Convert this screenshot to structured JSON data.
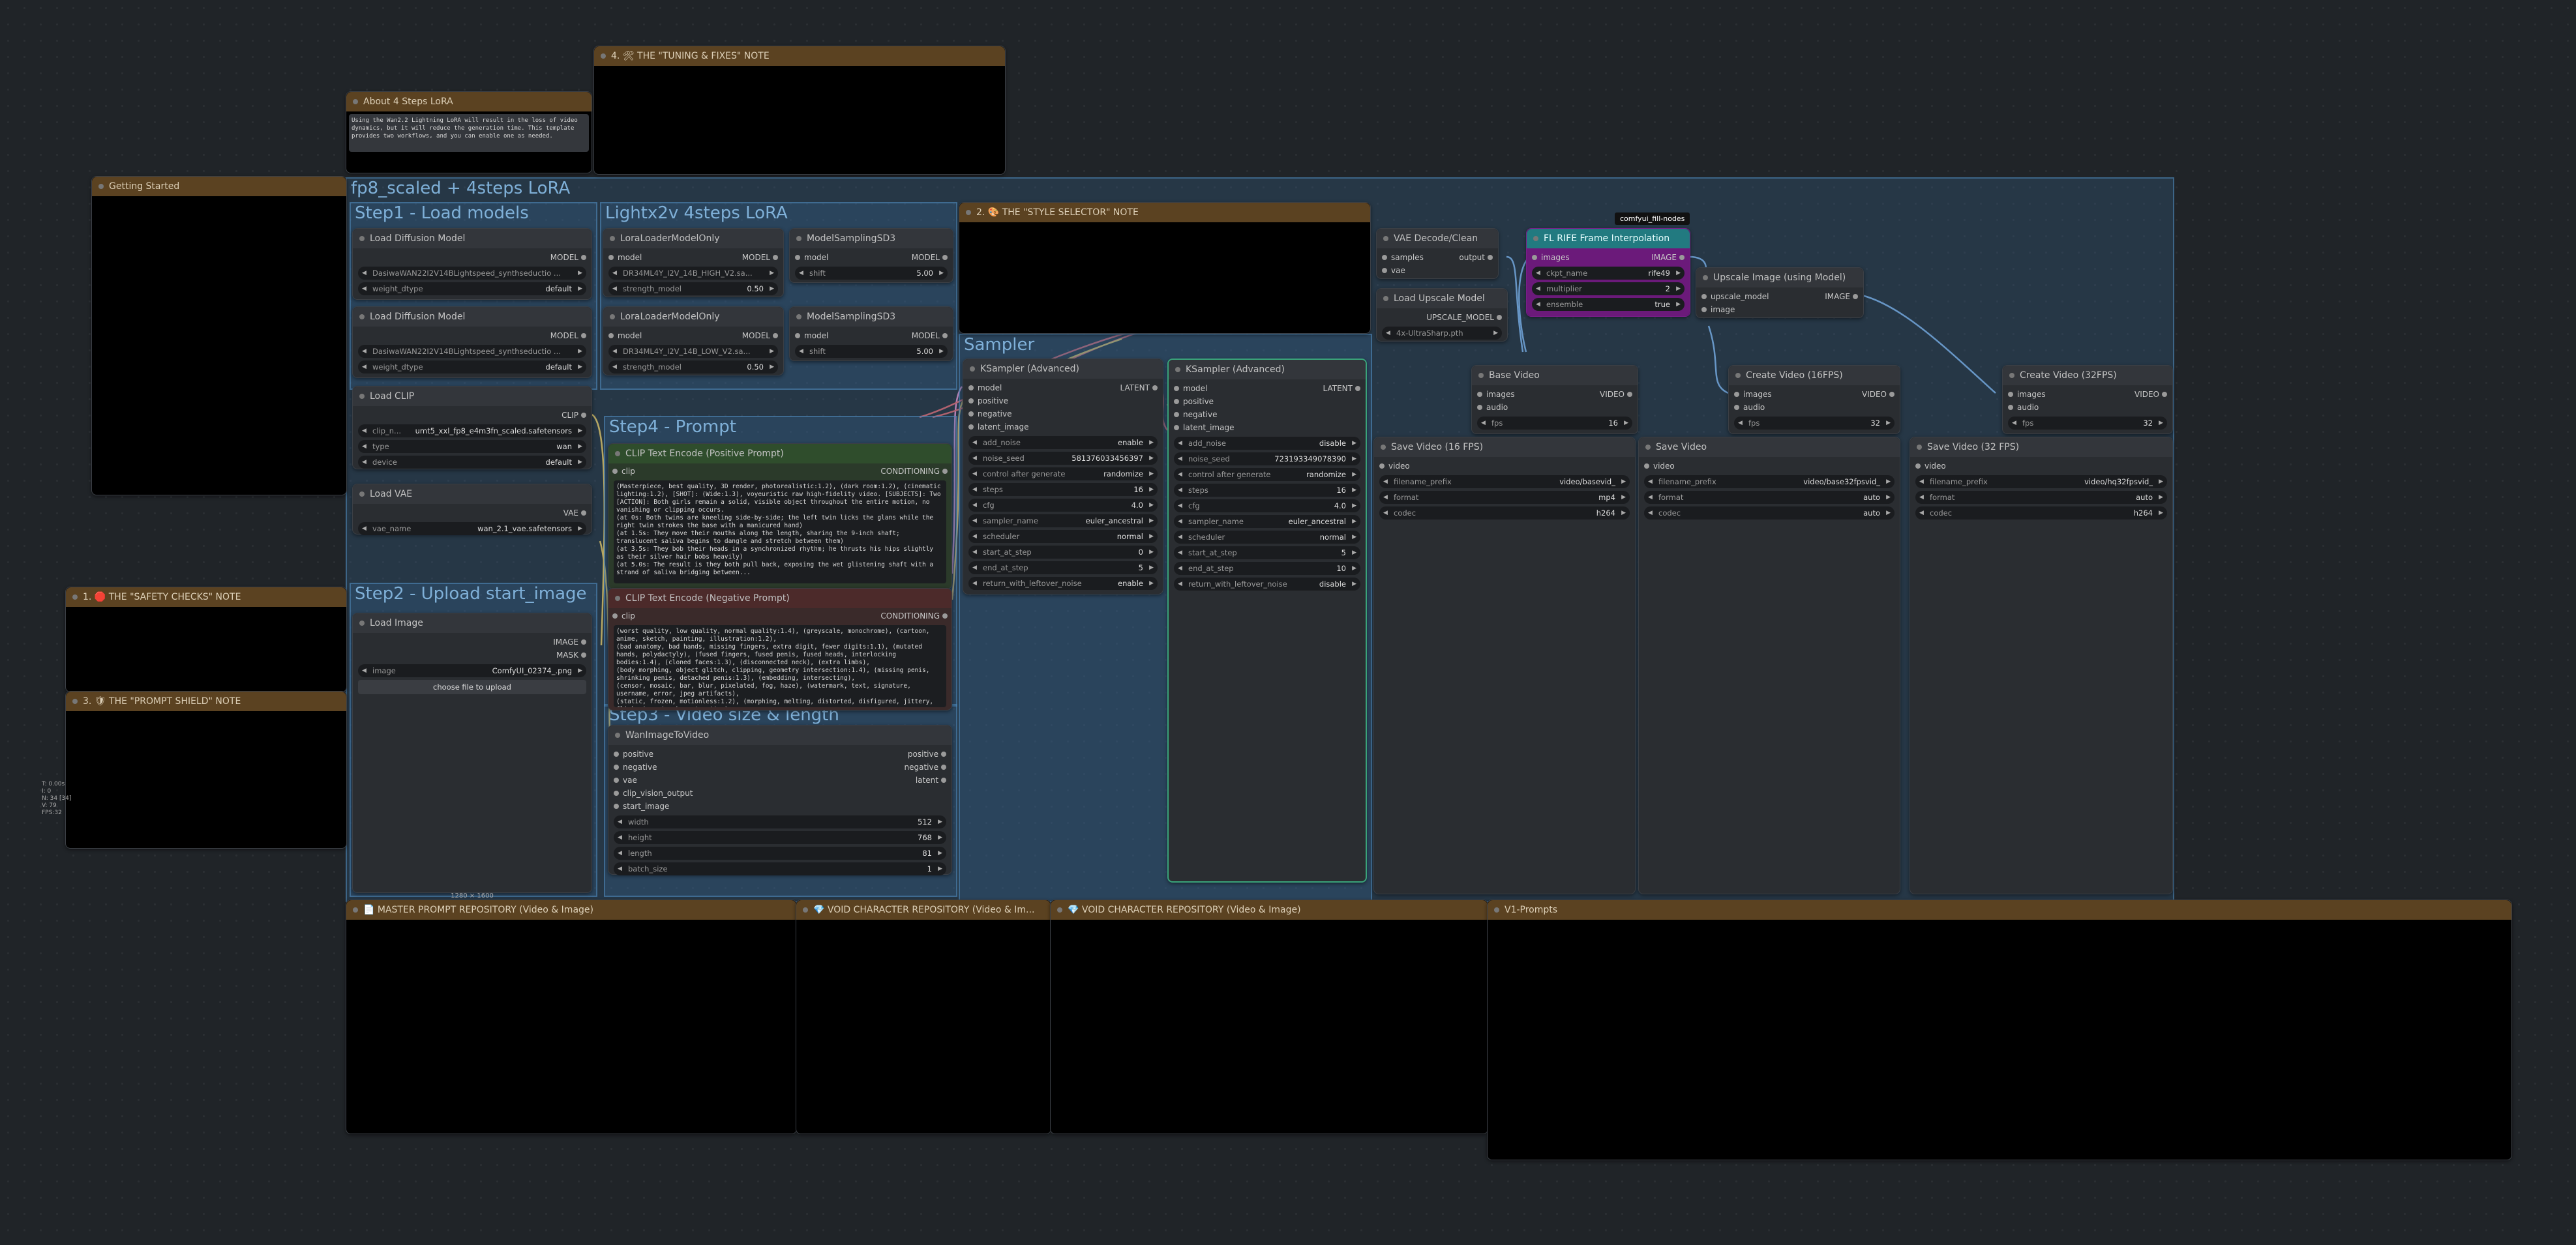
{
  "groups": {
    "main": "fp8_scaled +  4steps LoRA",
    "step1": "Step1 - Load models",
    "lightx": "Lightx2v 4steps LoRA",
    "step2": "Step2 - Upload start_image",
    "step3": "Step3 - Video size & length",
    "step4": "Step4 - Prompt",
    "sampler": "Sampler"
  },
  "notes": {
    "tuning": "4. 🛠 THE \"TUNING & FIXES\" NOTE",
    "about": "About 4 Steps LoRA",
    "about_text": "Using the Wan2.2 Lightning LoRA will result in the loss of video dynamics, but it will reduce the generation time. This template provides two workflows, and you can enable one as needed.",
    "getting_started": "Getting Started",
    "style": "2. 🎨 THE \"STYLE SELECTOR\" NOTE",
    "safety": "1. 🛑 THE \"SAFETY CHECKS\" NOTE",
    "shield": "3. 🛡 THE \"PROMPT SHIELD\" NOTE",
    "master": "📄 MASTER PROMPT REPOSITORY (Video & Image)",
    "void1": "💎 VOID CHARACTER REPOSITORY (Video & Im...",
    "void2": "💎 VOID CHARACTER REPOSITORY (Video & Image)",
    "v1": "V1-Prompts",
    "side_text": "T: 0.00s\nI: 0\nN: 34 [34]\nV: 79\nFPS:32"
  },
  "nodes": {
    "ldm1": {
      "title": "Load Diffusion Model",
      "out": "MODEL",
      "unet": "DasiwaWAN22I2V14BLightspeed_synthseductio ...",
      "dtype_label": "weight_dtype",
      "dtype": "default"
    },
    "ldm2": {
      "title": "Load Diffusion Model",
      "out": "MODEL",
      "unet": "DasiwaWAN22I2V14BLightspeed_synthseductio ...",
      "dtype_label": "weight_dtype",
      "dtype": "default"
    },
    "lora1": {
      "title": "LoraLoaderModelOnly",
      "in": "model",
      "out": "MODEL",
      "name": "DR34ML4Y_I2V_14B_HIGH_V2.sa...",
      "str_label": "strength_model",
      "str": "0.50"
    },
    "lora2": {
      "title": "LoraLoaderModelOnly",
      "in": "model",
      "out": "MODEL",
      "name": "DR34ML4Y_I2V_14B_LOW_V2.sa...",
      "str_label": "strength_model",
      "str": "0.50"
    },
    "ms1": {
      "title": "ModelSamplingSD3",
      "in": "model",
      "out": "MODEL",
      "shift_label": "shift",
      "shift": "5.00"
    },
    "ms2": {
      "title": "ModelSamplingSD3",
      "in": "model",
      "out": "MODEL",
      "shift_label": "shift",
      "shift": "5.00"
    },
    "clip": {
      "title": "Load CLIP",
      "out": "CLIP",
      "name_label": "clip_n...",
      "name": "umt5_xxl_fp8_e4m3fn_scaled.safetensors",
      "type_label": "type",
      "type": "wan",
      "device_label": "device",
      "device": "default"
    },
    "vae": {
      "title": "Load VAE",
      "out": "VAE",
      "name_label": "vae_name",
      "name": "wan_2.1_vae.safetensors"
    },
    "image": {
      "title": "Load Image",
      "out1": "IMAGE",
      "out2": "MASK",
      "label": "image",
      "file": "ComfyUI_02374_.png",
      "upload": "choose file to upload",
      "size": "1280 × 1600"
    },
    "pos": {
      "title": "CLIP Text Encode (Positive Prompt)",
      "in": "clip",
      "out": "CONDITIONING",
      "text": "(Masterpiece, best quality, 3D render, photorealistic:1.2), (dark room:1.2), (cinematic lighting:1.2), [SHOT]: (Wide:1.3), voyeuristic raw high-fidelity video. [SUBJECTS]: Two [ACTION]: Both girls remain a solid, visible object throughout the entire motion, no vanishing or clipping occurs.\n(at 0s: Both twins are kneeling side-by-side; the left twin licks the glans while the right twin strokes the base with a manicured hand)\n(at 1.5s: They move their mouths along the length, sharing the 9-inch shaft; translucent saliva begins to dangle and stretch between them)\n(at 3.5s: They bob their heads in a synchronized rhythm; he thrusts his hips slightly as their silver hair bobs heavily)\n(at 5.0s: The result is they both pull back, exposing the wet glistening shaft with a strand of saliva bridging between..."
    },
    "neg": {
      "title": "CLIP Text Encode (Negative Prompt)",
      "in": "clip",
      "out": "CONDITIONING",
      "text": "(worst quality, low quality, normal quality:1.4), (greyscale, monochrome), (cartoon, anime, sketch, painting, illustration:1.2),\n(bad anatomy, bad hands, missing fingers, extra digit, fewer digits:1.1), (mutated hands, polydactyly), (fused fingers, fused penis, fused heads, interlocking bodies:1.4), (cloned faces:1.3), (disconnected neck), (extra limbs),\n(body morphing, object glitch, clipping, geometry intersection:1.4), (missing penis, shrinking penis, detached penis:1.3), (embedding, intersecting),\n(censor, mosaic, bar, blur, pixelated, fog, haze), (watermark, text, signature, username, error, jpeg artifacts),\n(static, frozen, motionless:1.2), (morphing, melting, distorted, disfigured, jittery, flickering, incoherent motion)"
    },
    "wan": {
      "title": "WanImageToVideo",
      "ins": [
        "positive",
        "negative",
        "vae",
        "clip_vision_output",
        "start_image"
      ],
      "outs": [
        "positive",
        "negative",
        "latent"
      ],
      "width_label": "width",
      "width": "512",
      "height_label": "height",
      "height": "768",
      "length_label": "length",
      "length": "81",
      "batch_label": "batch_size",
      "batch": "1"
    },
    "ks1": {
      "title": "KSampler (Advanced)",
      "ins": [
        "model",
        "positive",
        "negative",
        "latent_image"
      ],
      "out": "LATENT",
      "rows": [
        [
          "add_noise",
          "enable"
        ],
        [
          "noise_seed",
          "581376033456397"
        ],
        [
          "control after generate",
          "randomize"
        ],
        [
          "steps",
          "16"
        ],
        [
          "cfg",
          "4.0"
        ],
        [
          "sampler_name",
          "euler_ancestral"
        ],
        [
          "scheduler",
          "normal"
        ],
        [
          "start_at_step",
          "0"
        ],
        [
          "end_at_step",
          "5"
        ],
        [
          "return_with_leftover_noise",
          "enable"
        ]
      ]
    },
    "ks2": {
      "title": "KSampler (Advanced)",
      "ins": [
        "model",
        "positive",
        "negative",
        "latent_image"
      ],
      "out": "LATENT",
      "rows": [
        [
          "add_noise",
          "disable"
        ],
        [
          "noise_seed",
          "723193349078390"
        ],
        [
          "control after generate",
          "randomize"
        ],
        [
          "steps",
          "16"
        ],
        [
          "cfg",
          "4.0"
        ],
        [
          "sampler_name",
          "euler_ancestral"
        ],
        [
          "scheduler",
          "normal"
        ],
        [
          "start_at_step",
          "5"
        ],
        [
          "end_at_step",
          "10"
        ],
        [
          "return_with_leftover_noise",
          "disable"
        ]
      ]
    },
    "vaedec": {
      "title": "VAE Decode/Clean",
      "ins": [
        "samples",
        "vae"
      ],
      "out": "output"
    },
    "upload": {
      "title": "Load Upscale Model",
      "out": "UPSCALE_MODEL",
      "name": "4x-UltraSharp.pth"
    },
    "rife": {
      "badge": "comfyui_fill-nodes",
      "title": "FL RIFE Frame Interpolation",
      "in": "images",
      "out": "IMAGE",
      "rows": [
        [
          "ckpt_name",
          "rife49"
        ],
        [
          "multiplier",
          "2"
        ],
        [
          "ensemble",
          "true"
        ]
      ]
    },
    "upimg": {
      "title": "Upscale Image (using Model)",
      "ins": [
        "upscale_model",
        "image"
      ],
      "out": "IMAGE"
    },
    "basevid": {
      "title": "Base Video",
      "ins": [
        "images",
        "audio"
      ],
      "out": "VIDEO",
      "fps_label": "fps",
      "fps": "16"
    },
    "cv16": {
      "title": "Create Video (16FPS)",
      "ins": [
        "images",
        "audio"
      ],
      "out": "VIDEO",
      "fps_label": "fps",
      "fps": "32"
    },
    "cv32": {
      "title": "Create Video (32FPS)",
      "ins": [
        "images",
        "audio"
      ],
      "out": "VIDEO",
      "fps_label": "fps",
      "fps": "32"
    },
    "sv16": {
      "title": "Save Video (16 FPS)",
      "in": "video",
      "rows": [
        [
          "filename_prefix",
          "video/basevid_"
        ],
        [
          "format",
          "mp4"
        ],
        [
          "codec",
          "h264"
        ]
      ]
    },
    "sv": {
      "title": "Save Video",
      "in": "video",
      "rows": [
        [
          "filename_prefix",
          "video/base32fpsvid_"
        ],
        [
          "format",
          "auto"
        ],
        [
          "codec",
          "auto"
        ]
      ]
    },
    "sv32": {
      "title": "Save Video (32 FPS)",
      "in": "video",
      "rows": [
        [
          "filename_prefix",
          "video/hq32fpsvid_"
        ],
        [
          "format",
          "auto"
        ],
        [
          "codec",
          "h264"
        ]
      ]
    }
  },
  "colors": {
    "canvas": "#202428",
    "group": "#37698f",
    "note": "#5b4221",
    "rife": "#7a1e8a",
    "teal": "#227a80"
  }
}
